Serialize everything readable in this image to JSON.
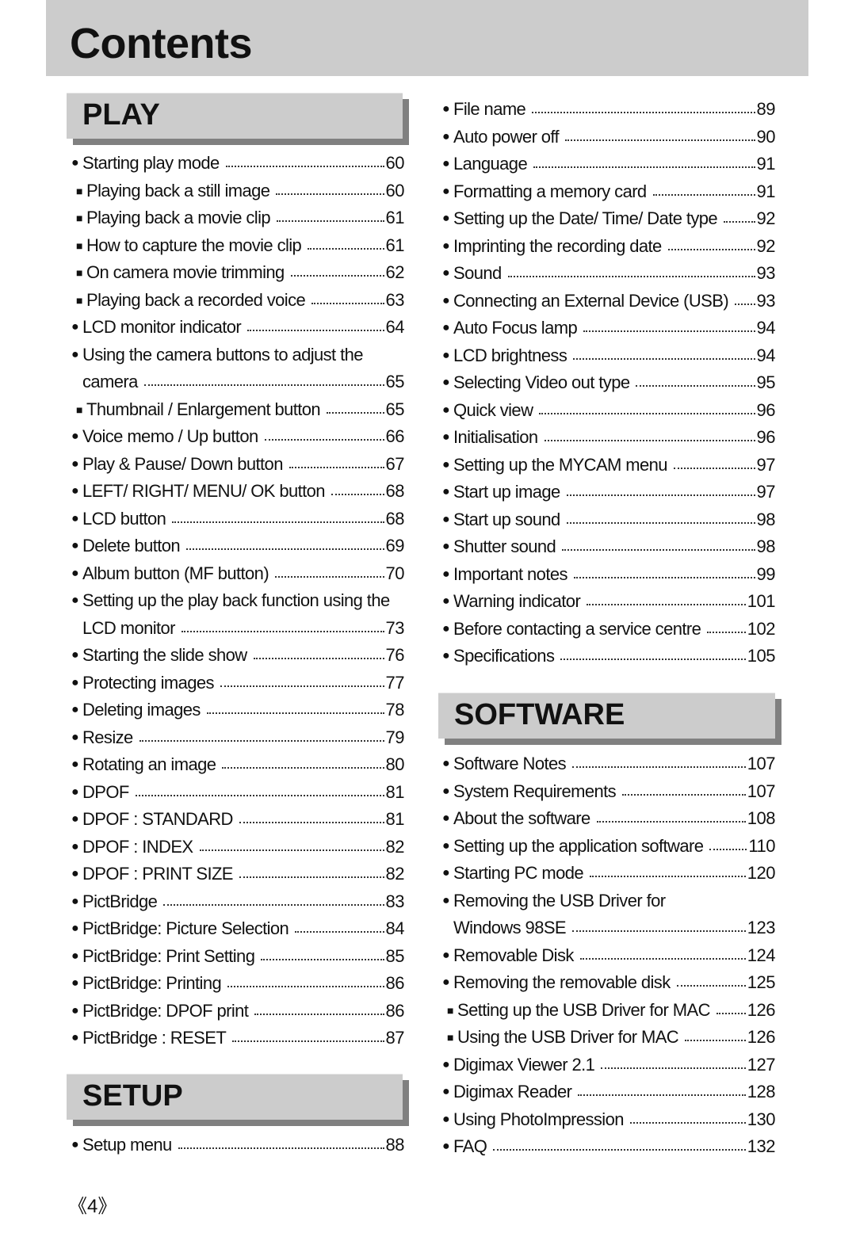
{
  "header": {
    "title": "Contents"
  },
  "sections": {
    "play": {
      "label": "PLAY",
      "entries": [
        {
          "bullet": "●",
          "title": "Starting play mode",
          "page": "60",
          "level": "main"
        },
        {
          "bullet": "■",
          "title": "Playing back a still image",
          "page": "60",
          "level": "sub"
        },
        {
          "bullet": "■",
          "title": "Playing back a movie clip",
          "page": "61",
          "level": "sub"
        },
        {
          "bullet": "■",
          "title": "How to capture the movie clip",
          "page": "61",
          "level": "sub"
        },
        {
          "bullet": "■",
          "title": "On camera movie trimming",
          "page": "62",
          "level": "sub"
        },
        {
          "bullet": "■",
          "title": "Playing back a recorded voice",
          "page": "63",
          "level": "sub"
        },
        {
          "bullet": "●",
          "title": "LCD monitor indicator",
          "page": "64",
          "level": "main"
        },
        {
          "bullet": "●",
          "title": "Using the camera buttons to adjust the",
          "page": "",
          "level": "main"
        },
        {
          "bullet": "●",
          "title": "camera",
          "page": "65",
          "level": "cont"
        },
        {
          "bullet": "■",
          "title": "Thumbnail / Enlargement button",
          "page": "65",
          "level": "sub"
        },
        {
          "bullet": "●",
          "title": "Voice memo / Up button",
          "page": "66",
          "level": "main"
        },
        {
          "bullet": "●",
          "title": "Play & Pause/ Down button",
          "page": "67",
          "level": "main"
        },
        {
          "bullet": "●",
          "title": "LEFT/ RIGHT/ MENU/ OK button",
          "page": "68",
          "level": "main"
        },
        {
          "bullet": "●",
          "title": "LCD button",
          "page": "68",
          "level": "main"
        },
        {
          "bullet": "●",
          "title": "Delete button",
          "page": "69",
          "level": "main"
        },
        {
          "bullet": "●",
          "title": "Album button (MF button)",
          "page": "70",
          "level": "main"
        },
        {
          "bullet": "●",
          "title": "Setting up the play back function using the",
          "page": "",
          "level": "main"
        },
        {
          "bullet": "●",
          "title": "LCD monitor",
          "page": "73",
          "level": "cont"
        },
        {
          "bullet": "●",
          "title": "Starting the slide show",
          "page": "76",
          "level": "main"
        },
        {
          "bullet": "●",
          "title": "Protecting images",
          "page": "77",
          "level": "main"
        },
        {
          "bullet": "●",
          "title": "Deleting images",
          "page": "78",
          "level": "main"
        },
        {
          "bullet": "●",
          "title": "Resize",
          "page": "79",
          "level": "main"
        },
        {
          "bullet": "●",
          "title": "Rotating an image",
          "page": "80",
          "level": "main"
        },
        {
          "bullet": "●",
          "title": "DPOF",
          "page": "81",
          "level": "main"
        },
        {
          "bullet": "●",
          "title": "DPOF : STANDARD",
          "page": "81",
          "level": "main"
        },
        {
          "bullet": "●",
          "title": "DPOF : INDEX",
          "page": "82",
          "level": "main"
        },
        {
          "bullet": "●",
          "title": "DPOF : PRINT SIZE",
          "page": "82",
          "level": "main"
        },
        {
          "bullet": "●",
          "title": "PictBridge",
          "page": "83",
          "level": "main"
        },
        {
          "bullet": "●",
          "title": "PictBridge: Picture Selection",
          "page": "84",
          "level": "main"
        },
        {
          "bullet": "●",
          "title": "PictBridge: Print Setting",
          "page": "85",
          "level": "main"
        },
        {
          "bullet": "●",
          "title": "PictBridge: Printing",
          "page": "86",
          "level": "main"
        },
        {
          "bullet": "●",
          "title": "PictBridge: DPOF print",
          "page": "86",
          "level": "main"
        },
        {
          "bullet": "●",
          "title": "PictBridge : RESET",
          "page": "87",
          "level": "main"
        }
      ]
    },
    "setup": {
      "label": "SETUP",
      "entries": [
        {
          "bullet": "●",
          "title": "Setup menu",
          "page": "88",
          "level": "main"
        },
        {
          "bullet": "●",
          "title": "File name",
          "page": "89",
          "level": "main"
        },
        {
          "bullet": "●",
          "title": "Auto power off",
          "page": "90",
          "level": "main"
        },
        {
          "bullet": "●",
          "title": "Language",
          "page": "91",
          "level": "main"
        },
        {
          "bullet": "●",
          "title": "Formatting a memory card",
          "page": "91",
          "level": "main"
        },
        {
          "bullet": "●",
          "title": "Setting up the Date/ Time/ Date type",
          "page": "92",
          "level": "main"
        },
        {
          "bullet": "●",
          "title": "Imprinting the recording date",
          "page": "92",
          "level": "main"
        },
        {
          "bullet": "●",
          "title": "Sound",
          "page": "93",
          "level": "main"
        },
        {
          "bullet": "●",
          "title": "Connecting an External Device (USB)",
          "page": "93",
          "level": "main"
        },
        {
          "bullet": "●",
          "title": "Auto Focus lamp",
          "page": "94",
          "level": "main"
        },
        {
          "bullet": "●",
          "title": "LCD brightness",
          "page": "94",
          "level": "main"
        },
        {
          "bullet": "●",
          "title": "Selecting Video out type",
          "page": "95",
          "level": "main"
        },
        {
          "bullet": "●",
          "title": "Quick view",
          "page": "96",
          "level": "main"
        },
        {
          "bullet": "●",
          "title": "Initialisation",
          "page": "96",
          "level": "main"
        },
        {
          "bullet": "●",
          "title": "Setting up the MYCAM menu",
          "page": "97",
          "level": "main"
        },
        {
          "bullet": "●",
          "title": "Start up image",
          "page": "97",
          "level": "main"
        },
        {
          "bullet": "●",
          "title": "Start up sound",
          "page": "98",
          "level": "main"
        },
        {
          "bullet": "●",
          "title": "Shutter sound",
          "page": "98",
          "level": "main"
        },
        {
          "bullet": "●",
          "title": "Important notes",
          "page": "99",
          "level": "main"
        },
        {
          "bullet": "●",
          "title": "Warning indicator",
          "page": "101",
          "level": "main"
        },
        {
          "bullet": "●",
          "title": "Before contacting a service centre",
          "page": "102",
          "level": "main"
        },
        {
          "bullet": "●",
          "title": "Specifications",
          "page": "105",
          "level": "main"
        }
      ]
    },
    "software": {
      "label": "SOFTWARE",
      "entries": [
        {
          "bullet": "●",
          "title": "Software Notes",
          "page": "107",
          "level": "main"
        },
        {
          "bullet": "●",
          "title": "System Requirements",
          "page": "107",
          "level": "main"
        },
        {
          "bullet": "●",
          "title": "About the software",
          "page": "108",
          "level": "main"
        },
        {
          "bullet": "●",
          "title": "Setting up the application software",
          "page": "110",
          "level": "main"
        },
        {
          "bullet": "●",
          "title": "Starting PC mode",
          "page": "120",
          "level": "main"
        },
        {
          "bullet": "●",
          "title": "Removing the USB Driver for",
          "page": "",
          "level": "main"
        },
        {
          "bullet": "●",
          "title": "Windows 98SE",
          "page": "123",
          "level": "cont"
        },
        {
          "bullet": "●",
          "title": "Removable Disk",
          "page": "124",
          "level": "main"
        },
        {
          "bullet": "●",
          "title": "Removing the removable disk",
          "page": "125",
          "level": "main"
        },
        {
          "bullet": "■",
          "title": "Setting up the USB Driver for MAC",
          "page": "126",
          "level": "sub"
        },
        {
          "bullet": "■",
          "title": "Using the USB Driver for MAC",
          "page": "126",
          "level": "sub"
        },
        {
          "bullet": "●",
          "title": "Digimax Viewer 2.1",
          "page": "127",
          "level": "main"
        },
        {
          "bullet": "●",
          "title": "Digimax Reader",
          "page": "128",
          "level": "main"
        },
        {
          "bullet": "●",
          "title": "Using PhotoImpression",
          "page": "130",
          "level": "main"
        },
        {
          "bullet": "●",
          "title": "FAQ",
          "page": "132",
          "level": "main"
        }
      ]
    }
  },
  "footer": {
    "page_number": "《4》"
  }
}
